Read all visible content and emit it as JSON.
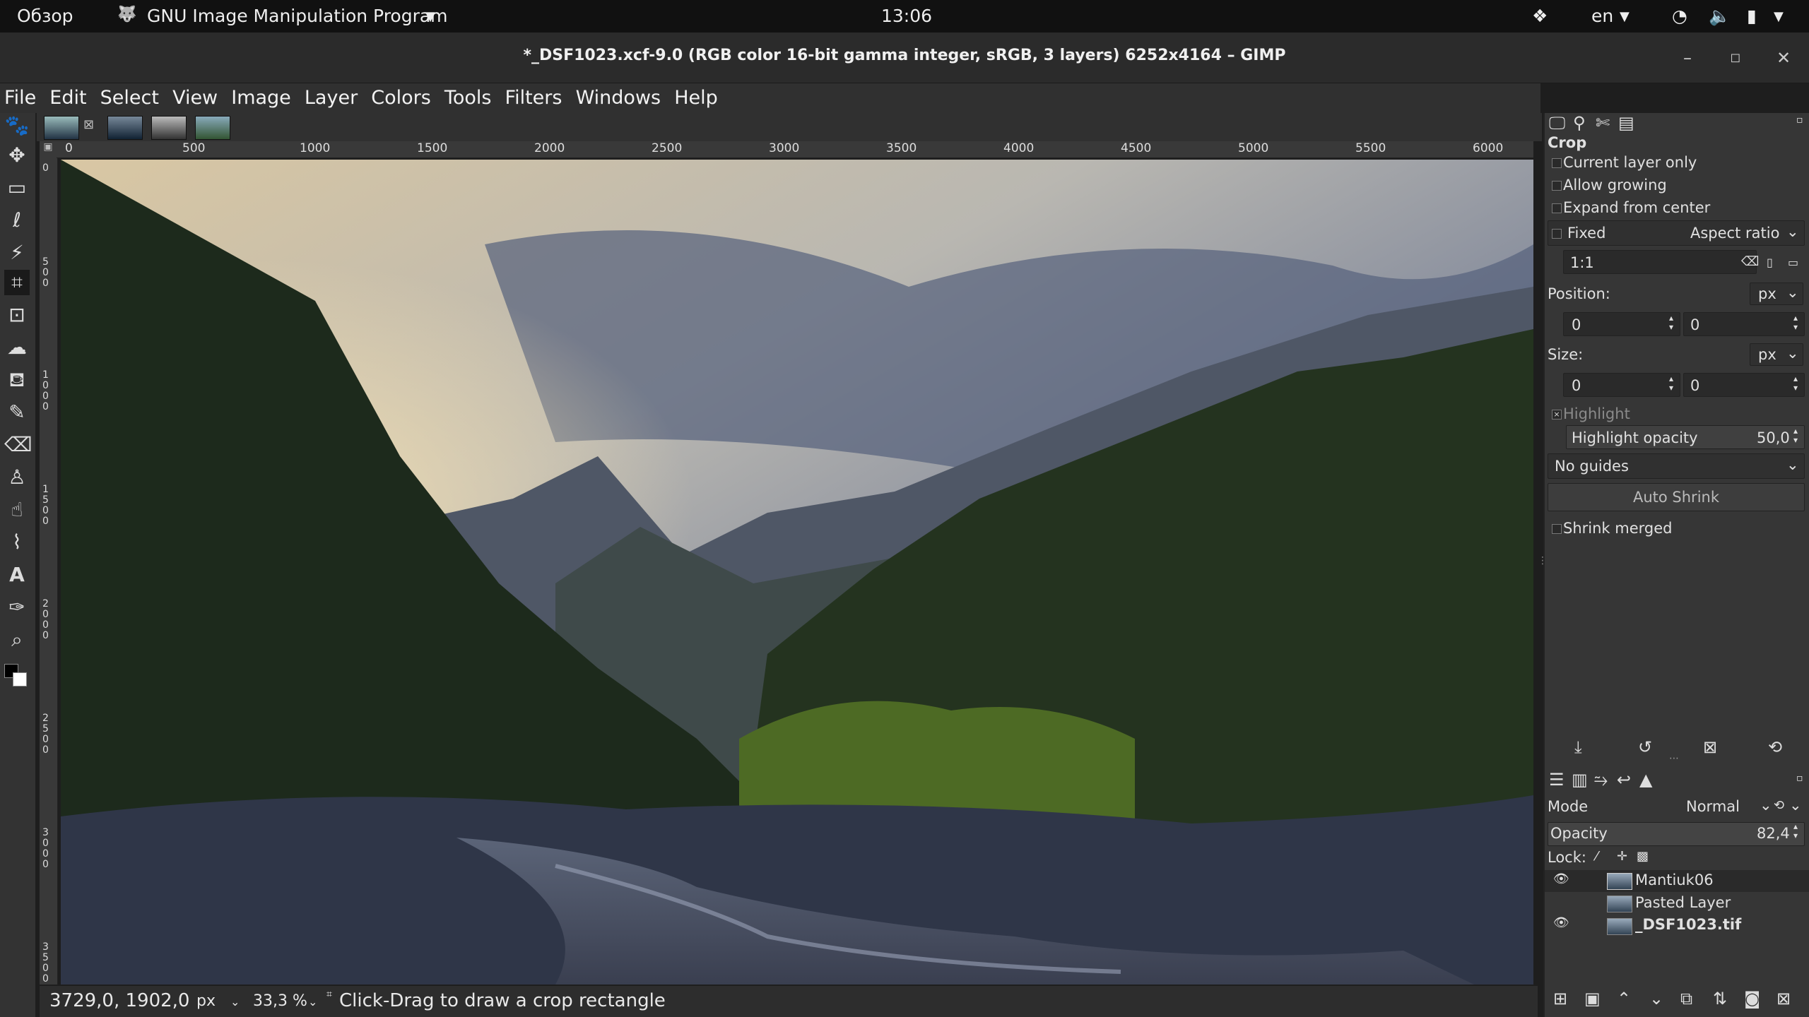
{
  "topbar": {
    "activities": "Обзор",
    "app_menu": "GNU Image Manipulation Program",
    "clock": "13:06",
    "lang": "en"
  },
  "window": {
    "title": "*_DSF1023.xcf-9.0 (RGB color 16-bit gamma integer, sRGB, 3 layers) 6252x4164 – GIMP"
  },
  "menu": [
    "File",
    "Edit",
    "Select",
    "View",
    "Image",
    "Layer",
    "Colors",
    "Tools",
    "Filters",
    "Windows",
    "Help"
  ],
  "ruler": {
    "h_labels": [
      "0",
      "500",
      "1000",
      "1500",
      "2000",
      "2500",
      "3000",
      "3500",
      "4000",
      "4500",
      "5000",
      "5500",
      "6000"
    ],
    "v_labels": [
      "0",
      "500",
      "1000",
      "1500",
      "2000",
      "2500",
      "3000",
      "3500"
    ]
  },
  "status": {
    "coords": "3729,0, 1902,0",
    "unit": "px",
    "zoom": "33,3 %",
    "message": "Click-Drag to draw a crop rectangle"
  },
  "crop": {
    "title": "Crop",
    "current_layer_only": "Current layer only",
    "allow_growing": "Allow growing",
    "expand_from_center": "Expand from center",
    "fixed": "Fixed",
    "fixed_mode": "Aspect ratio",
    "ratio": "1:1",
    "position_label": "Position:",
    "position_unit": "px",
    "pos_x": "0",
    "pos_y": "0",
    "size_label": "Size:",
    "size_unit": "px",
    "size_w": "0",
    "size_h": "0",
    "highlight": "Highlight",
    "highlight_opacity_label": "Highlight opacity",
    "highlight_opacity": "50,0",
    "guides": "No guides",
    "auto_shrink": "Auto Shrink",
    "shrink_merged": "Shrink merged"
  },
  "layers": {
    "mode_label": "Mode",
    "mode_value": "Normal",
    "opacity_label": "Opacity",
    "opacity_value": "82,4",
    "lock_label": "Lock:",
    "items": [
      {
        "name": "Mantiuk06",
        "visible": true
      },
      {
        "name": "Pasted Layer",
        "visible": false
      },
      {
        "name": "_DSF1023.tif",
        "visible": true
      }
    ]
  }
}
